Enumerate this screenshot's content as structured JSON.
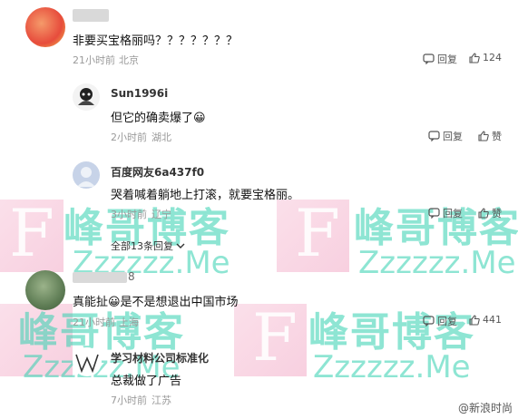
{
  "comments": [
    {
      "text": "非要买宝格丽吗？？？？？？？",
      "time": "21小时前",
      "location": "北京",
      "reply_label": "回复",
      "like_count": "124"
    },
    {
      "username": "Sun1996i",
      "text": "但它的确卖爆了😀",
      "time": "2小时前",
      "location": "湖北",
      "reply_label": "回复",
      "like_label": "赞"
    },
    {
      "username": "百度网友6a437f0",
      "text": "哭着喊着躺地上打滚，就要宝格丽。",
      "time": "3小时前",
      "location": "辽宁",
      "reply_label": "回复",
      "like_label": "赞",
      "expand_label": "全部13条回复"
    },
    {
      "username_partial": "8",
      "text": "真能扯😀是不是想退出中国市场",
      "time": "21小时前",
      "location": "上海",
      "reply_label": "回复",
      "like_count": "441"
    },
    {
      "username": "学习材料公司标准化",
      "text": "总裁做了广告",
      "time": "7小时前",
      "location": "江苏",
      "reply_label": "回复",
      "like_label": "赞"
    }
  ],
  "watermark": {
    "letter": "F",
    "cn": "峰哥博客",
    "en": "Zzzzzz.Me"
  },
  "footer_mark": "@新浪时尚"
}
